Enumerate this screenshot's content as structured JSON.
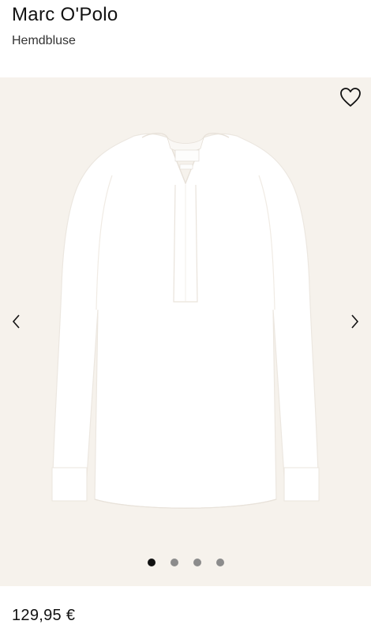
{
  "product": {
    "brand": "Marc O'Polo",
    "name": "Hemdbluse",
    "price": "129,95 €"
  },
  "gallery": {
    "background_color": "#f6f2ec",
    "image_count": 4,
    "active_index": 0,
    "icons": {
      "wishlist": "heart-outline-icon",
      "prev": "chevron-left-icon",
      "next": "chevron-right-icon"
    }
  },
  "colors": {
    "dot_active": "#111111",
    "dot_inactive": "#8c8c8c",
    "text": "#1a1a1a"
  }
}
